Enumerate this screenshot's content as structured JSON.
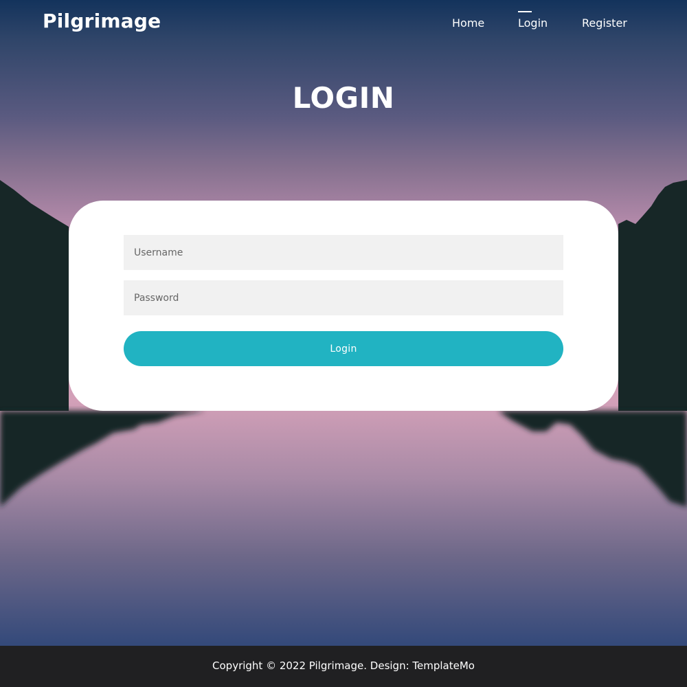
{
  "header": {
    "brand": "Pilgrimage",
    "nav": {
      "home": "Home",
      "login": "Login",
      "register": "Register"
    },
    "active_nav": "Login"
  },
  "page": {
    "title": "LOGIN"
  },
  "form": {
    "username_placeholder": "Username",
    "username_value": "",
    "password_placeholder": "Password",
    "password_value": "",
    "submit_label": "Login"
  },
  "footer": {
    "copyright": "Copyright © 2022 Pilgrimage. Design: TemplateMo"
  },
  "colors": {
    "accent": "#21b3c2",
    "footer_bg": "#202022",
    "input_bg": "#f1f1f1",
    "card_bg": "#ffffff",
    "mountain": "#172727"
  }
}
